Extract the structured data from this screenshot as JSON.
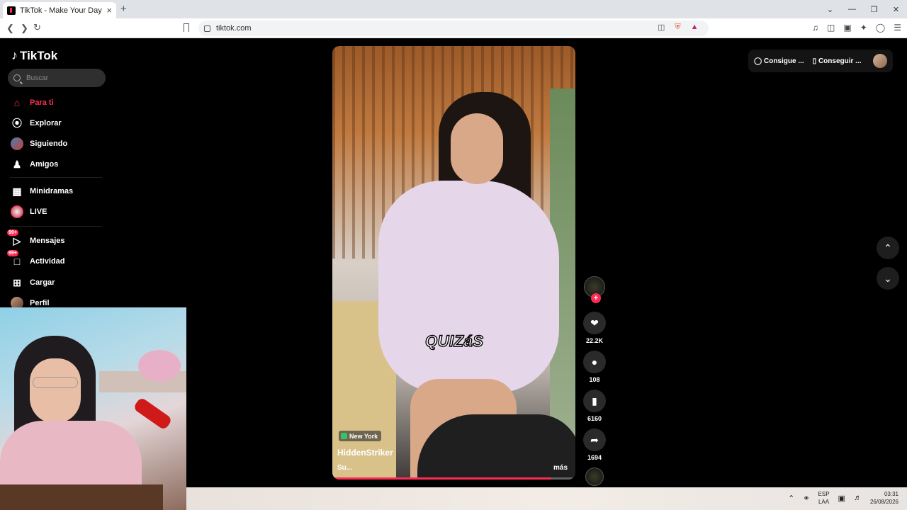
{
  "browser": {
    "tab_title": "TikTok - Make Your Day",
    "tab_close": "×",
    "new_tab": "+",
    "url": "tiktok.com",
    "window_controls": [
      "⌄",
      "—",
      "❐",
      "✕"
    ]
  },
  "sidebar": {
    "logo": "TikTok",
    "search_placeholder": "Buscar",
    "items": [
      {
        "label": "Para ti",
        "icon": "home-icon"
      },
      {
        "label": "Explorar",
        "icon": "compass-icon"
      },
      {
        "label": "Siguiendo",
        "icon": "following-avatar"
      },
      {
        "label": "Amigos",
        "icon": "friends-icon"
      },
      {
        "label": "Minidramas",
        "icon": "minidramas-icon"
      },
      {
        "label": "LIVE",
        "icon": "live-icon"
      },
      {
        "label": "Mensajes",
        "icon": "messages-icon",
        "badge": "99+"
      },
      {
        "label": "Actividad",
        "icon": "activity-icon",
        "badge": "99+"
      },
      {
        "label": "Cargar",
        "icon": "upload-icon"
      },
      {
        "label": "Perfil",
        "icon": "profile-avatar"
      }
    ]
  },
  "video": {
    "caption": "QUIZáS",
    "location": "New York",
    "author": "HiddenStriker",
    "description": "Su...",
    "more": "más",
    "progress": 0.9
  },
  "actions": {
    "likes": "22.2K",
    "comments": "108",
    "bookmarks": "6160",
    "shares": "1694"
  },
  "topright": {
    "coins": "Consigue ...",
    "app": "Conseguir ..."
  },
  "taskbar": {
    "lang_top": "ESP",
    "lang_bottom": "LAA",
    "time": "03:31",
    "date": "26/08/2026"
  },
  "colors": {
    "accent": "#fe2c55",
    "background": "#000000"
  }
}
